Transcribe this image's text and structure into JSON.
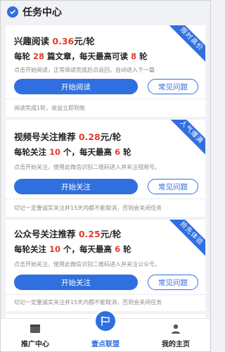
{
  "header": {
    "title": "任务中心",
    "icon": "check-circle-icon"
  },
  "tasks": [
    {
      "title": "兴趣阅读",
      "price": "0.36",
      "unit": "元/轮",
      "ribbon": "限时高价",
      "meta_prefix": "每轮",
      "meta_count": "28",
      "meta_mid": "篇文章，每天最高可读",
      "meta_max": "8",
      "meta_suffix": "轮",
      "desc": "点击开始阅读，正常阅读完成后点返回，自动进入下一篇",
      "start_label": "开始阅读",
      "faq_label": "常见问题",
      "foot": "阅读完成1轮，收益立即到账"
    },
    {
      "title": "视频号关注推荐",
      "price": "0.28",
      "unit": "元/轮",
      "ribbon": "人气爆满",
      "meta_prefix": "每轮关注",
      "meta_count": "10",
      "meta_mid": "个，每天最高",
      "meta_max": "6",
      "meta_suffix": "轮",
      "desc": "点击开始关注，使用此微信识别二维码进入并关注视频号。",
      "start_label": "开始关注",
      "faq_label": "常见问题",
      "foot": "切记一定要诚实关注并15天内都不能取消，否则会关闭任务"
    },
    {
      "title": "公众号关注推荐",
      "price": "0.25",
      "unit": "元/轮",
      "ribbon": "抢先体验",
      "meta_prefix": "每轮关注",
      "meta_count": "10",
      "meta_mid": "个，每天最高",
      "meta_max": "6",
      "meta_suffix": "轮",
      "desc": "点击开始关注，使用此微信识别二维码进入并关注公众号。",
      "start_label": "开始关注",
      "faq_label": "常见问题",
      "foot": "切记一定要诚实关注并15天内都不能取消，否则会关闭任务"
    }
  ],
  "tabbar": {
    "items": [
      {
        "label": "推广中心",
        "icon": "window-icon"
      },
      {
        "label": "壹点联盟",
        "icon": "flag-icon",
        "active": true
      },
      {
        "label": "我的主页",
        "icon": "user-icon"
      }
    ]
  },
  "colors": {
    "accent": "#2f6fe0",
    "price": "#e33b2b",
    "background": "#f1f2f6"
  }
}
